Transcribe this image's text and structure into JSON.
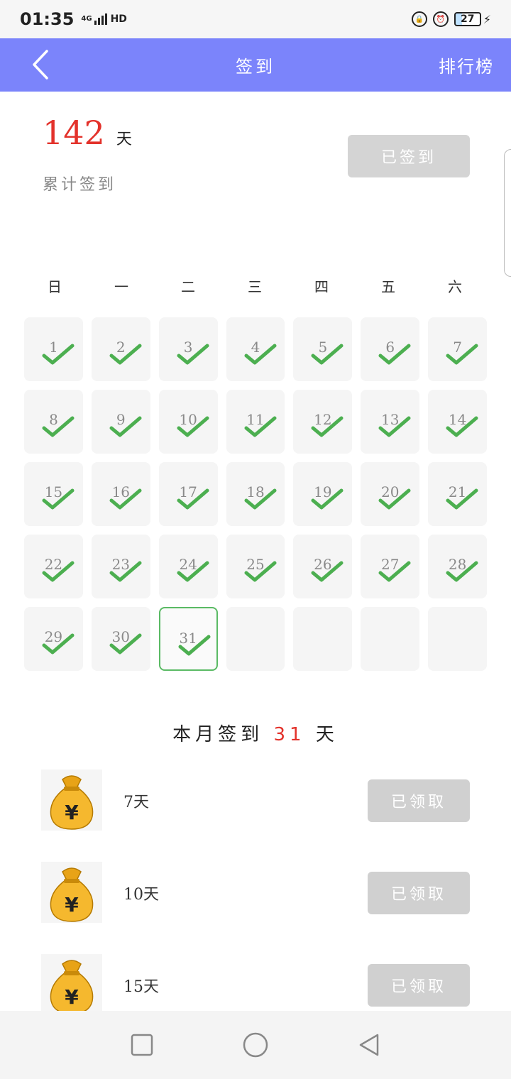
{
  "status_bar": {
    "time": "01:35",
    "network": "4G",
    "hd": "HD",
    "battery": "27"
  },
  "header": {
    "back_icon": "chevron-left-icon",
    "title": "签到",
    "ranking": "排行榜"
  },
  "summary": {
    "total_days": "142",
    "unit": "天",
    "label": "累计签到",
    "signed_button": "已签到"
  },
  "weekdays": [
    "日",
    "一",
    "二",
    "三",
    "四",
    "五",
    "六"
  ],
  "calendar": {
    "days": [
      "1",
      "2",
      "3",
      "4",
      "5",
      "6",
      "7",
      "8",
      "9",
      "10",
      "11",
      "12",
      "13",
      "14",
      "15",
      "16",
      "17",
      "18",
      "19",
      "20",
      "21",
      "22",
      "23",
      "24",
      "25",
      "26",
      "27",
      "28",
      "29",
      "30",
      "31"
    ],
    "today": "31",
    "check_color": "#4caf50"
  },
  "month_summary": {
    "prefix": "本月签到",
    "count": "31",
    "suffix": "天"
  },
  "rewards": [
    {
      "label": "7天",
      "button": "已领取",
      "icon": "money-bag-icon"
    },
    {
      "label": "10天",
      "button": "已领取",
      "icon": "money-bag-icon"
    },
    {
      "label": "15天",
      "button": "已领取",
      "icon": "money-bag-icon"
    }
  ],
  "colors": {
    "header": "#7b84fb",
    "accent_red": "#e3322b",
    "check_green": "#4caf50"
  }
}
